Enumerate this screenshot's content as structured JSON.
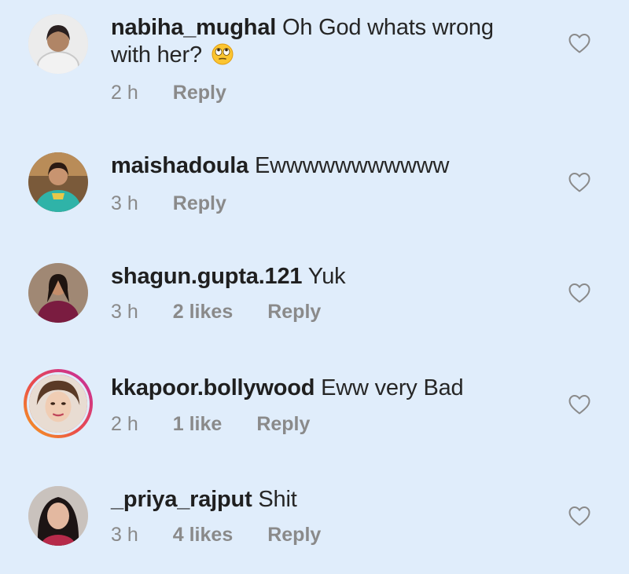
{
  "comments": [
    {
      "username": "nabiha_mughal",
      "text": "Oh God whats wrong with her?",
      "emoji": "face-with-rolling-eyes",
      "time": "2 h",
      "likes": "",
      "reply_label": "Reply",
      "has_story_ring": false
    },
    {
      "username": "maishadoula",
      "text": "Ewwwwwwwwwww",
      "time": "3 h",
      "likes": "",
      "reply_label": "Reply",
      "has_story_ring": false
    },
    {
      "username": "shagun.gupta.121",
      "text": "Yuk",
      "time": "3 h",
      "likes": "2 likes",
      "reply_label": "Reply",
      "has_story_ring": false
    },
    {
      "username": "kkapoor.bollywood",
      "text": "Eww very Bad",
      "time": "2 h",
      "likes": "1 like",
      "reply_label": "Reply",
      "has_story_ring": true
    },
    {
      "username": "_priya_rajput",
      "text": "Shit",
      "time": "3 h",
      "likes": "4 likes",
      "reply_label": "Reply",
      "has_story_ring": false
    }
  ],
  "icons": {
    "like": "heart-outline-icon",
    "emoji": "face-with-rolling-eyes"
  },
  "colors": {
    "background": "#e0edfb",
    "username": "#1f1f1f",
    "meta": "#8a8a8a",
    "heart": "#8a8a8a",
    "story_ring_start": "#f6a21c",
    "story_ring_end": "#c32aa3"
  }
}
